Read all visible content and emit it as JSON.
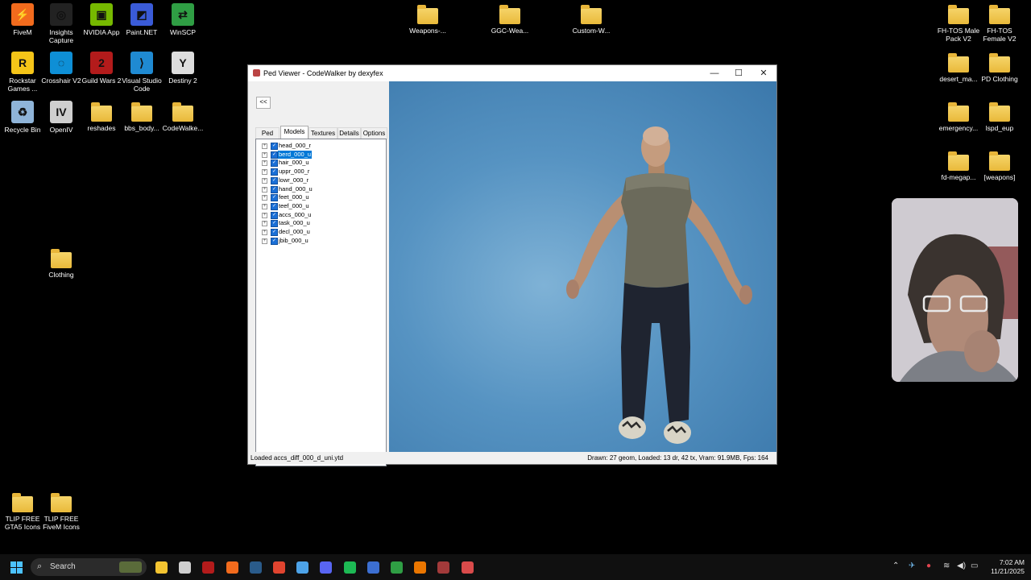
{
  "desktop": {
    "icons_left": [
      {
        "label": "FiveM",
        "icon": "fivem-icon",
        "color": "#f26b1d"
      },
      {
        "label": "Insights Capture",
        "icon": "insights-capture-icon",
        "color": "#222222"
      },
      {
        "label": "NVIDIA App",
        "icon": "nvidia-icon",
        "color": "#76b900"
      },
      {
        "label": "Paint.NET",
        "icon": "paintnet-icon",
        "color": "#3a5bd8"
      },
      {
        "label": "WinSCP",
        "icon": "winscp-icon",
        "color": "#2f9e44"
      },
      {
        "label": "Rockstar Games ...",
        "icon": "rockstar-icon",
        "color": "#f5c518"
      },
      {
        "label": "Crosshair V2",
        "icon": "crosshair-icon",
        "color": "#0e8fd6"
      },
      {
        "label": "Guild Wars 2",
        "icon": "guildwars-icon",
        "color": "#b31b1b"
      },
      {
        "label": "Visual Studio Code",
        "icon": "vscode-icon",
        "color": "#1f8ad2"
      },
      {
        "label": "Destiny 2",
        "icon": "destiny-icon",
        "color": "#dddddd"
      },
      {
        "label": "Recycle Bin",
        "icon": "recycle-bin-icon",
        "color": "#8fb4d8"
      },
      {
        "label": "OpenIV",
        "icon": "openiv-icon",
        "color": "#cfcfcf"
      },
      {
        "label": "reshades",
        "icon": "folder-icon",
        "color": ""
      },
      {
        "label": "bbs_body...",
        "icon": "folder-icon",
        "color": ""
      },
      {
        "label": "CodeWalke...",
        "icon": "folder-icon",
        "color": ""
      },
      {
        "label": "Clothing",
        "icon": "folder-icon",
        "color": ""
      },
      {
        "label": "TLIP FREE GTA5 Icons",
        "icon": "folder-icon",
        "color": ""
      },
      {
        "label": "TLIP FREE FiveM Icons",
        "icon": "folder-icon",
        "color": ""
      }
    ],
    "icons_top": [
      {
        "label": "Weapons-...",
        "icon": "folder-icon"
      },
      {
        "label": "GGC-Wea...",
        "icon": "folder-icon"
      },
      {
        "label": "Custom-W...",
        "icon": "folder-icon"
      }
    ],
    "icons_right": [
      {
        "label": "FH-TOS Male Pack V2",
        "icon": "folder-icon"
      },
      {
        "label": "FH-TOS Female V2",
        "icon": "folder-icon"
      },
      {
        "label": "desert_ma...",
        "icon": "folder-icon"
      },
      {
        "label": "PD Clothing",
        "icon": "folder-icon"
      },
      {
        "label": "emergency...",
        "icon": "folder-icon"
      },
      {
        "label": "lspd_eup",
        "icon": "folder-icon"
      },
      {
        "label": "fd-megap...",
        "icon": "folder-icon"
      },
      {
        "label": "[weapons]",
        "icon": "folder-icon"
      }
    ]
  },
  "window": {
    "title": "Ped Viewer - CodeWalker by dexyfex",
    "minimize": "—",
    "maximize": "☐",
    "close": "✕",
    "collapse_button": "<<",
    "tabs": [
      {
        "label": "Ped",
        "active": false
      },
      {
        "label": "Models",
        "active": true
      },
      {
        "label": "Textures",
        "active": false
      },
      {
        "label": "Details",
        "active": false
      },
      {
        "label": "Options",
        "active": false
      }
    ],
    "tree": [
      {
        "label": "head_000_r",
        "checked": true,
        "selected": false
      },
      {
        "label": "berd_000_u",
        "checked": true,
        "selected": true
      },
      {
        "label": "hair_000_u",
        "checked": true,
        "selected": false
      },
      {
        "label": "uppr_000_r",
        "checked": true,
        "selected": false
      },
      {
        "label": "lowr_000_r",
        "checked": true,
        "selected": false
      },
      {
        "label": "hand_000_u",
        "checked": true,
        "selected": false
      },
      {
        "label": "feet_000_u",
        "checked": true,
        "selected": false
      },
      {
        "label": "teef_000_u",
        "checked": true,
        "selected": false
      },
      {
        "label": "accs_000_u",
        "checked": true,
        "selected": false
      },
      {
        "label": "task_000_u",
        "checked": true,
        "selected": false
      },
      {
        "label": "decl_000_u",
        "checked": true,
        "selected": false
      },
      {
        "label": "jbib_000_u",
        "checked": true,
        "selected": false
      }
    ],
    "status_left": "Loaded accs_diff_000_d_uni.ytd",
    "status_right": "Drawn: 27 geom, Loaded: 13 dr, 42 tx, Vram: 91.9MB, Fps: 164"
  },
  "taskbar": {
    "search_placeholder": "Search",
    "apps": [
      {
        "icon": "file-explorer-icon",
        "color": "#f3c431"
      },
      {
        "icon": "wolf-app-icon",
        "color": "#cfcfcf"
      },
      {
        "icon": "guildwars-icon",
        "color": "#b31b1b"
      },
      {
        "icon": "fivem-icon",
        "color": "#f26b1d"
      },
      {
        "icon": "steam-icon",
        "color": "#2a5b8a"
      },
      {
        "icon": "chrome-icon",
        "color": "#e0442f"
      },
      {
        "icon": "notepad-icon",
        "color": "#4da3e8"
      },
      {
        "icon": "discord-icon",
        "color": "#5865f2"
      },
      {
        "icon": "spotify-icon",
        "color": "#1db954"
      },
      {
        "icon": "model-viewer-icon",
        "color": "#3c6fd1"
      },
      {
        "icon": "winscp-icon",
        "color": "#2f9e44"
      },
      {
        "icon": "blender-icon",
        "color": "#ea7600"
      },
      {
        "icon": "archive-icon",
        "color": "#a23a3a"
      },
      {
        "icon": "codewalker-icon",
        "color": "#d94b4b"
      }
    ],
    "time": "7:02 AM",
    "date": "11/21/2025"
  }
}
